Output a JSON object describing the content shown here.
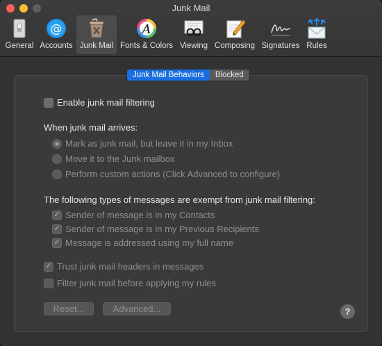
{
  "window": {
    "title": "Junk Mail"
  },
  "toolbar": {
    "items": [
      {
        "label": "General",
        "icon": "general-icon"
      },
      {
        "label": "Accounts",
        "icon": "at-sign-icon"
      },
      {
        "label": "Junk Mail",
        "icon": "junk-bin-icon",
        "active": true
      },
      {
        "label": "Fonts & Colors",
        "icon": "color-font-icon"
      },
      {
        "label": "Viewing",
        "icon": "viewing-glasses-icon"
      },
      {
        "label": "Composing",
        "icon": "composing-pencil-icon"
      },
      {
        "label": "Signatures",
        "icon": "signature-icon"
      },
      {
        "label": "Rules",
        "icon": "rules-envelope-icon"
      }
    ]
  },
  "tabs": {
    "behaviors": "Junk Mail Behaviors",
    "blocked": "Blocked",
    "active": "behaviors"
  },
  "content": {
    "enable_filtering": {
      "label": "Enable junk mail filtering",
      "checked": false
    },
    "arrives_heading": "When junk mail arrives:",
    "arrive_options": [
      {
        "label": "Mark as junk mail, but leave it in my Inbox",
        "selected": true
      },
      {
        "label": "Move it to the Junk mailbox",
        "selected": false
      },
      {
        "label": "Perform custom actions (Click Advanced to configure)",
        "selected": false
      }
    ],
    "exempt_heading": "The following types of messages are exempt from junk mail filtering:",
    "exempt_options": [
      {
        "label": "Sender of message is in my Contacts",
        "checked": true
      },
      {
        "label": "Sender of message is in my Previous Recipients",
        "checked": true
      },
      {
        "label": "Message is addressed using my full name",
        "checked": true
      }
    ],
    "trust_headers": {
      "label": "Trust junk mail headers in messages",
      "checked": true
    },
    "filter_before_rules": {
      "label": "Filter junk mail before applying my rules",
      "checked": false
    },
    "reset_button": "Reset...",
    "advanced_button": "Advanced...",
    "help_button": "?"
  },
  "colors": {
    "accent": "#1a6fe0",
    "window_bg": "#323232",
    "panel_bg": "#3a3a3a"
  }
}
